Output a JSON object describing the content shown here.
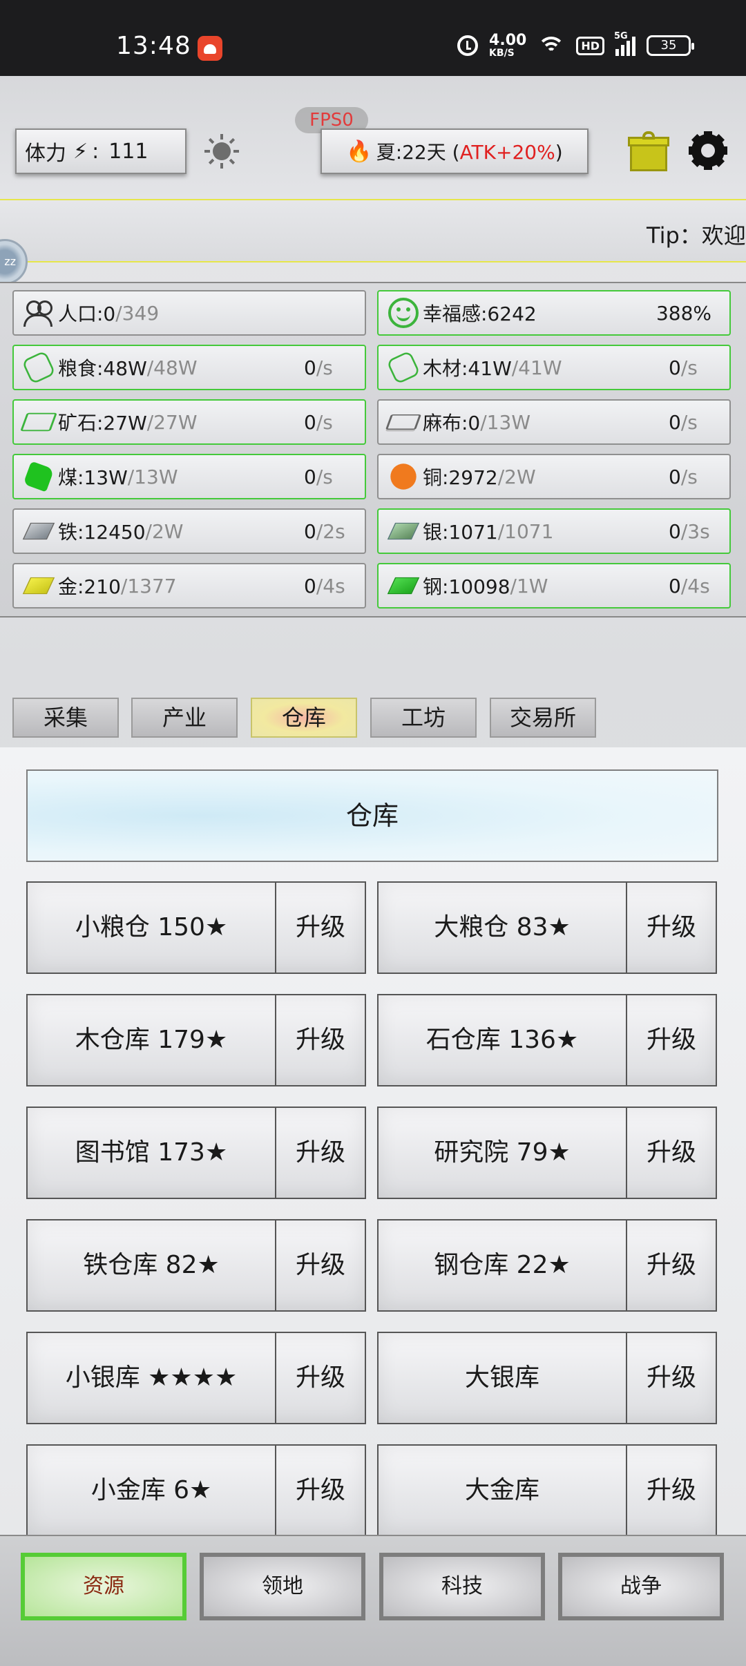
{
  "status_bar": {
    "time": "13:48",
    "net_speed_value": "4.00",
    "net_speed_unit": "KB/S",
    "hd_label": "HD",
    "signal_label": "5G",
    "battery": "35"
  },
  "hud": {
    "fps_label": "FPS0",
    "stamina_label": "体力",
    "stamina_sep": ":",
    "stamina_value": "111",
    "season_text": "夏:22天 (",
    "season_bonus": "ATK+20%",
    "season_close": ")",
    "tip_text": "Tip：欢迎",
    "float_ball_label": "zz"
  },
  "resources": [
    {
      "icon": "people-icon",
      "name": "人口:0",
      "cap": "/349",
      "rate": "",
      "unit": "",
      "green": false
    },
    {
      "icon": "smile-icon",
      "name": "幸福感:6242",
      "cap": "",
      "rate": "",
      "unit": "",
      "percent": "388%",
      "green": true
    },
    {
      "icon": "grain-icon",
      "name": "粮食:48W",
      "cap": "/48W",
      "rate": "0",
      "unit": "/s",
      "green": true
    },
    {
      "icon": "wood-icon",
      "name": "木材:41W",
      "cap": "/41W",
      "rate": "0",
      "unit": "/s",
      "green": true
    },
    {
      "icon": "ore-icon",
      "name": "矿石:27W",
      "cap": "/27W",
      "rate": "0",
      "unit": "/s",
      "green": true
    },
    {
      "icon": "cloth-icon",
      "name": "麻布:0",
      "cap": "/13W",
      "rate": "0",
      "unit": "/s",
      "green": false
    },
    {
      "icon": "coal-icon",
      "name": "煤:13W",
      "cap": "/13W",
      "rate": "0",
      "unit": "/s",
      "green": true
    },
    {
      "icon": "copper-icon",
      "name": "铜:2972",
      "cap": "/2W",
      "rate": "0",
      "unit": "/s",
      "green": false
    },
    {
      "icon": "iron-icon",
      "name": "铁:12450",
      "cap": "/2W",
      "rate": "0",
      "unit": "/2s",
      "green": false
    },
    {
      "icon": "silver-icon",
      "name": "银:1071",
      "cap": "/1071",
      "rate": "0",
      "unit": "/3s",
      "green": true
    },
    {
      "icon": "gold-icon",
      "name": "金:210",
      "cap": "/1377",
      "rate": "0",
      "unit": "/4s",
      "green": false
    },
    {
      "icon": "steel-icon",
      "name": "钢:10098",
      "cap": "/1W",
      "rate": "0",
      "unit": "/4s",
      "green": true
    }
  ],
  "tabs": [
    "采集",
    "产业",
    "仓库",
    "工坊",
    "交易所"
  ],
  "active_tab": "仓库",
  "panel_title": "仓库",
  "buildings": [
    {
      "name": "小粮仓  150★",
      "action": "升级"
    },
    {
      "name": "大粮仓  83★",
      "action": "升级"
    },
    {
      "name": "木仓库  179★",
      "action": "升级"
    },
    {
      "name": "石仓库  136★",
      "action": "升级"
    },
    {
      "name": "图书馆  173★",
      "action": "升级"
    },
    {
      "name": "研究院  79★",
      "action": "升级"
    },
    {
      "name": "铁仓库  82★",
      "action": "升级"
    },
    {
      "name": "钢仓库  22★",
      "action": "升级"
    },
    {
      "name": "小银库  ★★★★",
      "action": "升级"
    },
    {
      "name": "大银库",
      "action": "升级"
    },
    {
      "name": "小金库  6★",
      "action": "升级"
    },
    {
      "name": "大金库",
      "action": "升级"
    }
  ],
  "bottom_nav": [
    "资源",
    "领地",
    "科技",
    "战争"
  ],
  "active_nav": "资源",
  "colors": {
    "green_border": "#44c93a",
    "alert_red": "#e02020",
    "active_nav": "#56cc36"
  }
}
